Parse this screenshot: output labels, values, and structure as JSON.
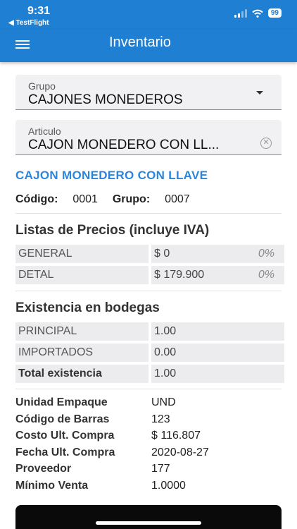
{
  "status_bar": {
    "time": "9:31",
    "back_app": "◀ TestFlight",
    "battery": "99"
  },
  "app_bar": {
    "title": "Inventario"
  },
  "grupo_field": {
    "label": "Grupo",
    "value": "CAJONES MONEDEROS"
  },
  "articulo_field": {
    "label": "Articulo",
    "value": "CAJON MONEDERO CON LL..."
  },
  "product": {
    "name": "CAJON MONEDERO CON LLAVE",
    "codigo_label": "Código:",
    "codigo_value": "0001",
    "grupo_label": "Grupo:",
    "grupo_value": "0007"
  },
  "prices": {
    "title": "Listas de Precios (incluye IVA)",
    "rows": [
      {
        "name": "GENERAL",
        "price": "$ 0",
        "pct": "0%"
      },
      {
        "name": "DETAL",
        "price": "$ 179.900",
        "pct": "0%"
      }
    ]
  },
  "stock": {
    "title": "Existencia en bodegas",
    "rows": [
      {
        "name": "PRINCIPAL",
        "qty": "1.00"
      },
      {
        "name": "IMPORTADOS",
        "qty": "0.00"
      }
    ],
    "total_label": "Total existencia",
    "total_value": "1.00"
  },
  "details": [
    {
      "label": "Unidad Empaque",
      "value": "UND"
    },
    {
      "label": "Código de Barras",
      "value": "123"
    },
    {
      "label": "Costo Ult. Compra",
      "value": "$ 116.807"
    },
    {
      "label": "Fecha Ult. Compra",
      "value": "2020-08-27"
    },
    {
      "label": "Proveedor",
      "value": "177"
    },
    {
      "label": "Mínimo Venta",
      "value": "1.0000"
    }
  ]
}
